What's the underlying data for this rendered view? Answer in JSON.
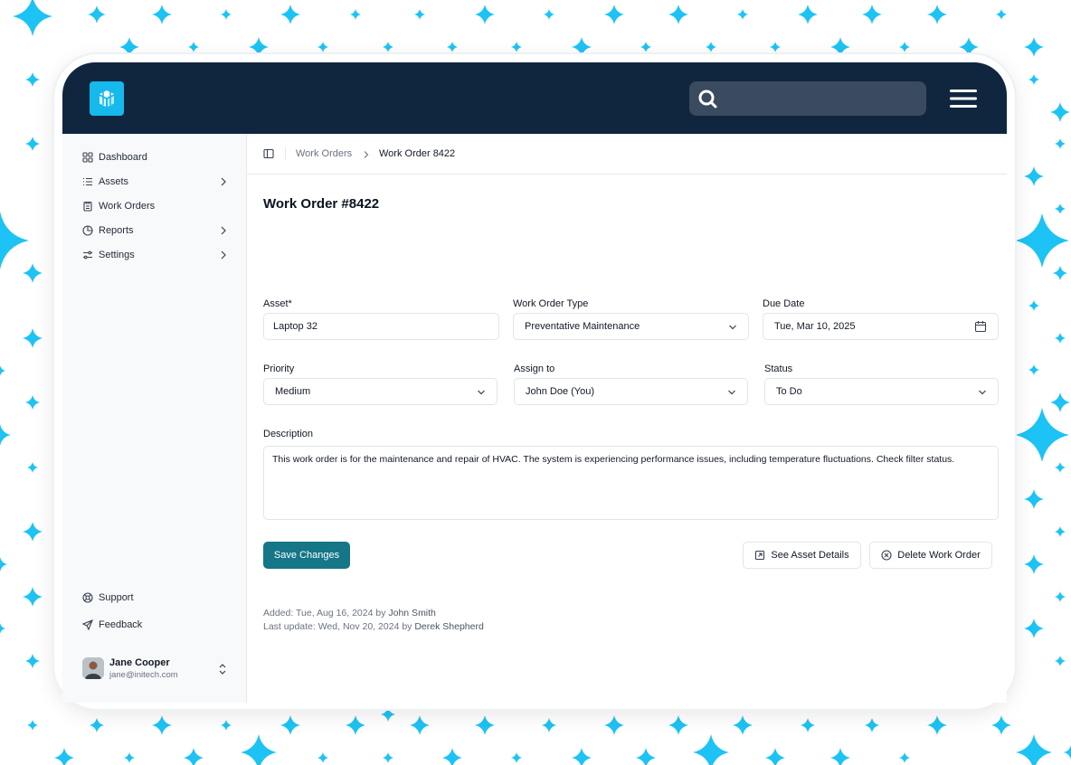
{
  "colors": {
    "background_star": "#1cc3f4",
    "topbar": "#10263f",
    "logo": "#15b9ec",
    "primary_button": "#157688"
  },
  "topbar": {
    "logo_icon": "cube-logo-icon",
    "search": {
      "placeholder": "",
      "value": "",
      "icon": "search-icon"
    },
    "menu_icon": "hamburger-menu-icon"
  },
  "sidebar": {
    "items": [
      {
        "label": "Dashboard",
        "icon": "grid-icon",
        "has_submenu": false
      },
      {
        "label": "Assets",
        "icon": "list-icon",
        "has_submenu": true
      },
      {
        "label": "Work Orders",
        "icon": "clipboard-icon",
        "has_submenu": false
      },
      {
        "label": "Reports",
        "icon": "pie-chart-icon",
        "has_submenu": true
      },
      {
        "label": "Settings",
        "icon": "sliders-icon",
        "has_submenu": true
      }
    ],
    "footer_items": [
      {
        "label": "Support",
        "icon": "lifebuoy-icon"
      },
      {
        "label": "Feedback",
        "icon": "send-icon"
      }
    ],
    "user": {
      "name": "Jane Cooper",
      "email": "jane@initech.com"
    }
  },
  "breadcrumb": {
    "parent": "Work Orders",
    "current": "Work Order 8422"
  },
  "form": {
    "title": "Work Order #8422",
    "asset": {
      "label": "Asset*",
      "value": "Laptop 32"
    },
    "type": {
      "label": "Work Order Type",
      "value": "Preventative Maintenance"
    },
    "due": {
      "label": "Due Date",
      "value": "Tue, Mar 10, 2025"
    },
    "priority": {
      "label": "Priority",
      "value": "Medium"
    },
    "assign": {
      "label": "Assign to",
      "value": "John Doe (You)"
    },
    "status": {
      "label": "Status",
      "value": "To Do"
    },
    "description": {
      "label": "Description",
      "value": "This work order is for the maintenance and repair of HVAC. The system is experiencing performance issues, including temperature fluctuations. Check filter status."
    }
  },
  "actions": {
    "save": "Save Changes",
    "see_asset": "See Asset Details",
    "delete": "Delete Work Order"
  },
  "meta": {
    "added_prefix": "Added: Tue, Aug 16, 2024 by",
    "added_by": "John Smith",
    "updated_prefix": "Last update: Wed, Nov 20, 2024 by",
    "updated_by": "Derek Shepherd"
  }
}
